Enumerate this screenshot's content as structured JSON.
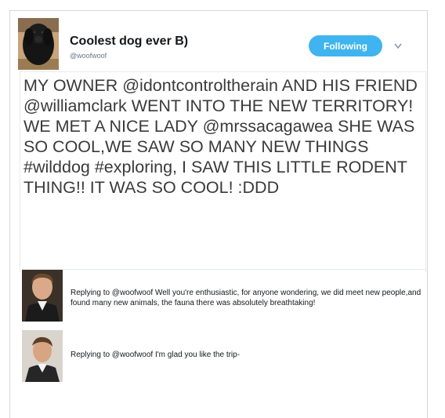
{
  "profile": {
    "display_name": "Coolest dog ever B)",
    "handle": "@woofwoof",
    "avatar_icon": "newfoundland-dog-photo"
  },
  "follow_button": {
    "label": "Following",
    "color": "#3fb4ee"
  },
  "menu": {
    "icon": "chevron-down-icon"
  },
  "tweet": {
    "text": "MY OWNER @idontcontroltherain AND HIS FRIEND @williamclark WENT INTO THE NEW TERRITORY! WE MET A NICE LADY @mrssacagawea SHE WAS SO COOL,WE SAW SO MANY NEW THINGS #wilddog #exploring, I SAW THIS LITTLE RODENT THING!! IT WAS SO COOL! :DDD"
  },
  "replies": [
    {
      "avatar_icon": "portrait-avatar-1",
      "text": "Replying to @woofwoof Well you're enthusiastic, for anyone wondering, we did meet new people,and found many new animals, the fauna there was absolutely breathtaking!"
    },
    {
      "avatar_icon": "portrait-avatar-2",
      "text": "Replying to @woofwoof I'm glad you like the trip-"
    }
  ]
}
